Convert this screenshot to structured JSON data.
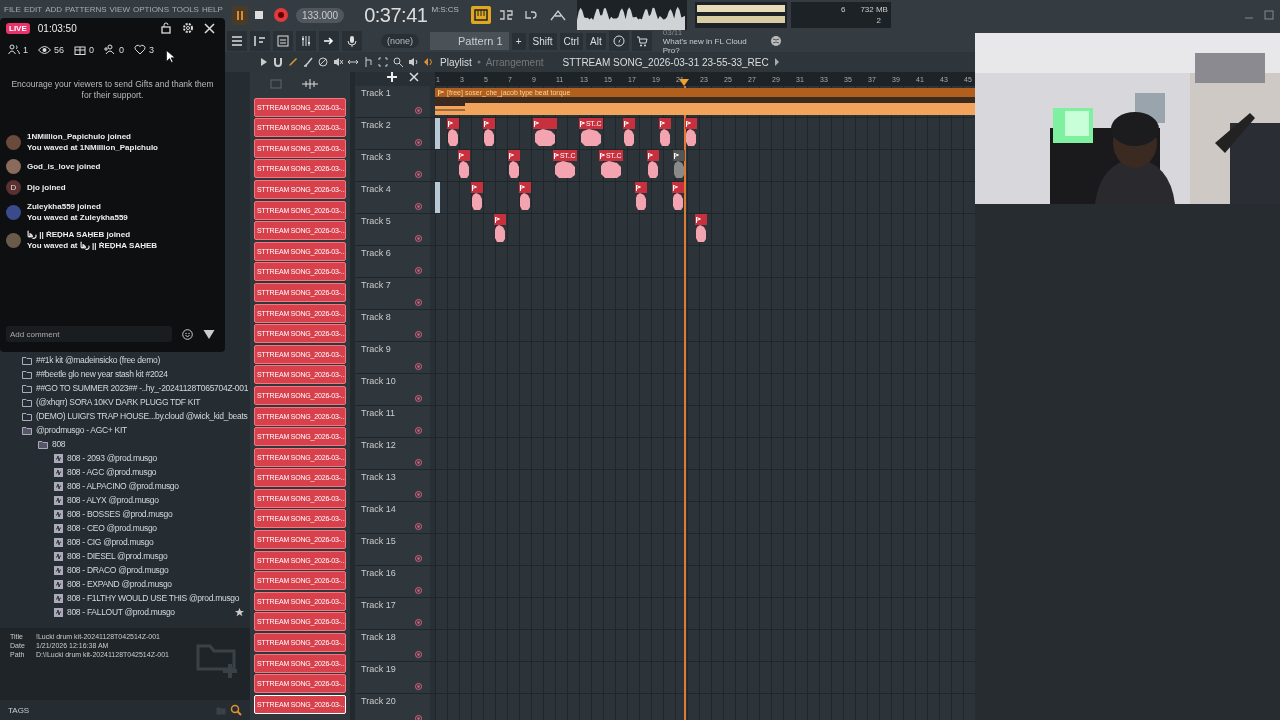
{
  "menu_bar": [
    "FILE",
    "EDIT",
    "ADD",
    "PATTERNS",
    "VIEW",
    "OPTIONS",
    "TOOLS",
    "HELP"
  ],
  "transport": {
    "playing": true,
    "record_armed": true,
    "tempo": "133.000",
    "time": "0:37:41",
    "time_unit": "M:S:CS"
  },
  "monitor": {
    "cpu": "6",
    "memory": "732 MB",
    "polyphony": "2"
  },
  "pattern_selector": {
    "channel": "(none)",
    "pattern": "Pattern 1",
    "add": "+"
  },
  "modifier_keys": [
    "Shift",
    "Ctrl",
    "Alt"
  ],
  "hint": {
    "date": "03/11",
    "text": "What's new in FL Cloud Pro?"
  },
  "playlist": {
    "title": "Playlist",
    "view": "Arrangement",
    "arrangement": "STTREAM SONG_2026-03-31 23-55-33_REC",
    "ruler": [
      "1",
      "3",
      "5",
      "7",
      "9",
      "11",
      "13",
      "15",
      "17",
      "19",
      "21",
      "23",
      "25",
      "27",
      "29",
      "31",
      "33",
      "35",
      "37",
      "39",
      "41",
      "43",
      "45"
    ],
    "tracks": [
      {
        "name": "Track 1",
        "clips": [
          {
            "kind": "audio",
            "label": "[free] soser_che_jacob type beat torque",
            "muted": false
          }
        ]
      },
      {
        "name": "Track 2",
        "clips": [
          {
            "kind": "pattern",
            "muted": false
          },
          {
            "kind": "pattern",
            "muted": false
          },
          {
            "kind": "pattern",
            "muted": false
          },
          {
            "kind": "pattern",
            "label": "ST..C",
            "muted": false
          },
          {
            "kind": "pattern",
            "muted": false
          },
          {
            "kind": "pattern",
            "muted": false
          },
          {
            "kind": "pattern",
            "muted": false
          }
        ]
      },
      {
        "name": "Track 3",
        "clips": [
          {
            "kind": "pattern",
            "muted": false
          },
          {
            "kind": "pattern",
            "muted": false
          },
          {
            "kind": "pattern",
            "label": "ST..C",
            "muted": false
          },
          {
            "kind": "pattern",
            "label": "ST..C",
            "muted": false
          },
          {
            "kind": "pattern",
            "muted": false
          },
          {
            "kind": "pattern",
            "muted": true
          }
        ]
      },
      {
        "name": "Track 4",
        "clips": [
          {
            "kind": "pattern",
            "muted": false
          },
          {
            "kind": "pattern",
            "muted": false
          },
          {
            "kind": "pattern",
            "muted": false
          },
          {
            "kind": "pattern",
            "muted": false
          }
        ]
      },
      {
        "name": "Track 5",
        "clips": [
          {
            "kind": "pattern",
            "muted": false
          },
          {
            "kind": "pattern",
            "muted": false
          }
        ]
      },
      {
        "name": "Track 6"
      },
      {
        "name": "Track 7"
      },
      {
        "name": "Track 8"
      },
      {
        "name": "Track 9"
      },
      {
        "name": "Track 10"
      },
      {
        "name": "Track 11"
      },
      {
        "name": "Track 12"
      },
      {
        "name": "Track 13"
      },
      {
        "name": "Track 14"
      },
      {
        "name": "Track 15"
      },
      {
        "name": "Track 16"
      },
      {
        "name": "Track 17"
      },
      {
        "name": "Track 18"
      },
      {
        "name": "Track 19"
      },
      {
        "name": "Track 20"
      }
    ]
  },
  "patterns": [
    "STTREAM SONG_2026-03-...",
    "STTREAM SONG_2026-03-...",
    "STTREAM SONG_2026-03-...",
    "STTREAM SONG_2026-03-...",
    "STTREAM SONG_2026-03-...",
    "STTREAM SONG_2026-03-...",
    "STTREAM SONG_2026-03-...",
    "STTREAM SONG_2026-03-...",
    "STTREAM SONG_2026-03-...",
    "STTREAM SONG_2026-03-...",
    "STTREAM SONG_2026-03-...",
    "STTREAM SONG_2026-03-...",
    "STTREAM SONG_2026-03-...",
    "STTREAM SONG_2026-03-...",
    "STTREAM SONG_2026-03-...",
    "STTREAM SONG_2026-03-...",
    "STTREAM SONG_2026-03-...",
    "STTREAM SONG_2026-03-...",
    "STTREAM SONG_2026-03-...",
    "STTREAM SONG_2026-03-...",
    "STTREAM SONG_2026-03-...",
    "STTREAM SONG_2026-03-...",
    "STTREAM SONG_2026-03-...",
    "STTREAM SONG_2026-03-...",
    "STTREAM SONG_2026-03-...",
    "STTREAM SONG_2026-03-...",
    "STTREAM SONG_2026-03-...",
    "STTREAM SONG_2026-03-...",
    "STTREAM SONG_2026-03-...",
    "STTREAM SONG_2026-03-..."
  ],
  "browser": {
    "items": [
      {
        "kind": "folder",
        "label": "##1k kit @madeinsicko (free demo)",
        "expanded": false
      },
      {
        "kind": "folder",
        "label": "##beetle glo new year stash kit #2024",
        "expanded": false
      },
      {
        "kind": "folder",
        "label": "##GO TO SUMMER 2023## -..hy_-20241128T065704Z-001",
        "expanded": false
      },
      {
        "kind": "folder",
        "label": "(@xhqrr) SORA 10KV DARK PLUGG TDF KIT",
        "expanded": false
      },
      {
        "kind": "folder",
        "label": "(DEMO) LUIGI'S TRAP HOUSE...by.cloud @wick_kid_beats",
        "expanded": false
      },
      {
        "kind": "folder",
        "label": "@prodmusgo - AGC+ KIT",
        "expanded": true,
        "children": [
          {
            "kind": "folder",
            "label": "808",
            "expanded": true,
            "children": [
              {
                "kind": "file",
                "label": "808 - 2093 @prod.musgo"
              },
              {
                "kind": "file",
                "label": "808 - AGC @prod.musgo"
              },
              {
                "kind": "file",
                "label": "808 - ALPACINO @prod.musgo"
              },
              {
                "kind": "file",
                "label": "808 - ALYX @prod.musgo"
              },
              {
                "kind": "file",
                "label": "808 - BOSSES @prod.musgo"
              },
              {
                "kind": "file",
                "label": "808 - CEO @prod.musgo"
              },
              {
                "kind": "file",
                "label": "808 - CIG @prod.musgo"
              },
              {
                "kind": "file",
                "label": "808 - DIESEL @prod.musgo"
              },
              {
                "kind": "file",
                "label": "808 - DRACO @prod.musgo"
              },
              {
                "kind": "file",
                "label": "808 - EXPAND @prod.musgo"
              },
              {
                "kind": "file",
                "label": "808 - F1LTHY WOULD USE THIS @prod.musgo"
              },
              {
                "kind": "file",
                "label": "808 - FALLOUT @prod.musgo"
              }
            ]
          }
        ]
      }
    ]
  },
  "info": [
    {
      "label": "Title",
      "value": "!Lucki drum kit-20241128T042514Z-001"
    },
    {
      "label": "Date",
      "value": "1/21/2026 12:16:38 AM"
    },
    {
      "label": "Path",
      "value": "D:\\!Lucki drum kit-20241128T042514Z-001"
    }
  ],
  "tags": {
    "label": "TAGS"
  },
  "live_overlay": {
    "badge": "LIVE",
    "duration": "01:03:50",
    "stats": [
      {
        "kind": "viewers",
        "value": "1"
      },
      {
        "kind": "views",
        "value": "56"
      },
      {
        "kind": "gifts",
        "value": "0"
      },
      {
        "kind": "follows",
        "value": "0"
      },
      {
        "kind": "likes",
        "value": "3"
      }
    ],
    "notice": "Encourage your viewers to send Gifts and thank them for their support.",
    "chat": [
      {
        "color": "#6a4a3a",
        "name": "1NMillion_Papichulo",
        "action": "joined",
        "wave": "You waved at 1NMillion_Papichulo"
      },
      {
        "color": "#8a6a5a",
        "name": "God_is_love",
        "action": "joined"
      },
      {
        "color": "#5a3030",
        "initial": "D",
        "name": "Djo",
        "action": "joined"
      },
      {
        "color": "#3a4a8a",
        "name": "Zuleykha559",
        "action": "joined",
        "wave": "You waved at Zuleykha559"
      },
      {
        "color": "#6a5a4a",
        "name": "رها || ṘEḌHA SAḤEB",
        "action": "joined",
        "wave": "You waved at رها || ṘEḌHA SAḤEB"
      }
    ],
    "comment": {
      "placeholder": "Add comment"
    }
  },
  "webcam": {
    "kind": "picture"
  }
}
